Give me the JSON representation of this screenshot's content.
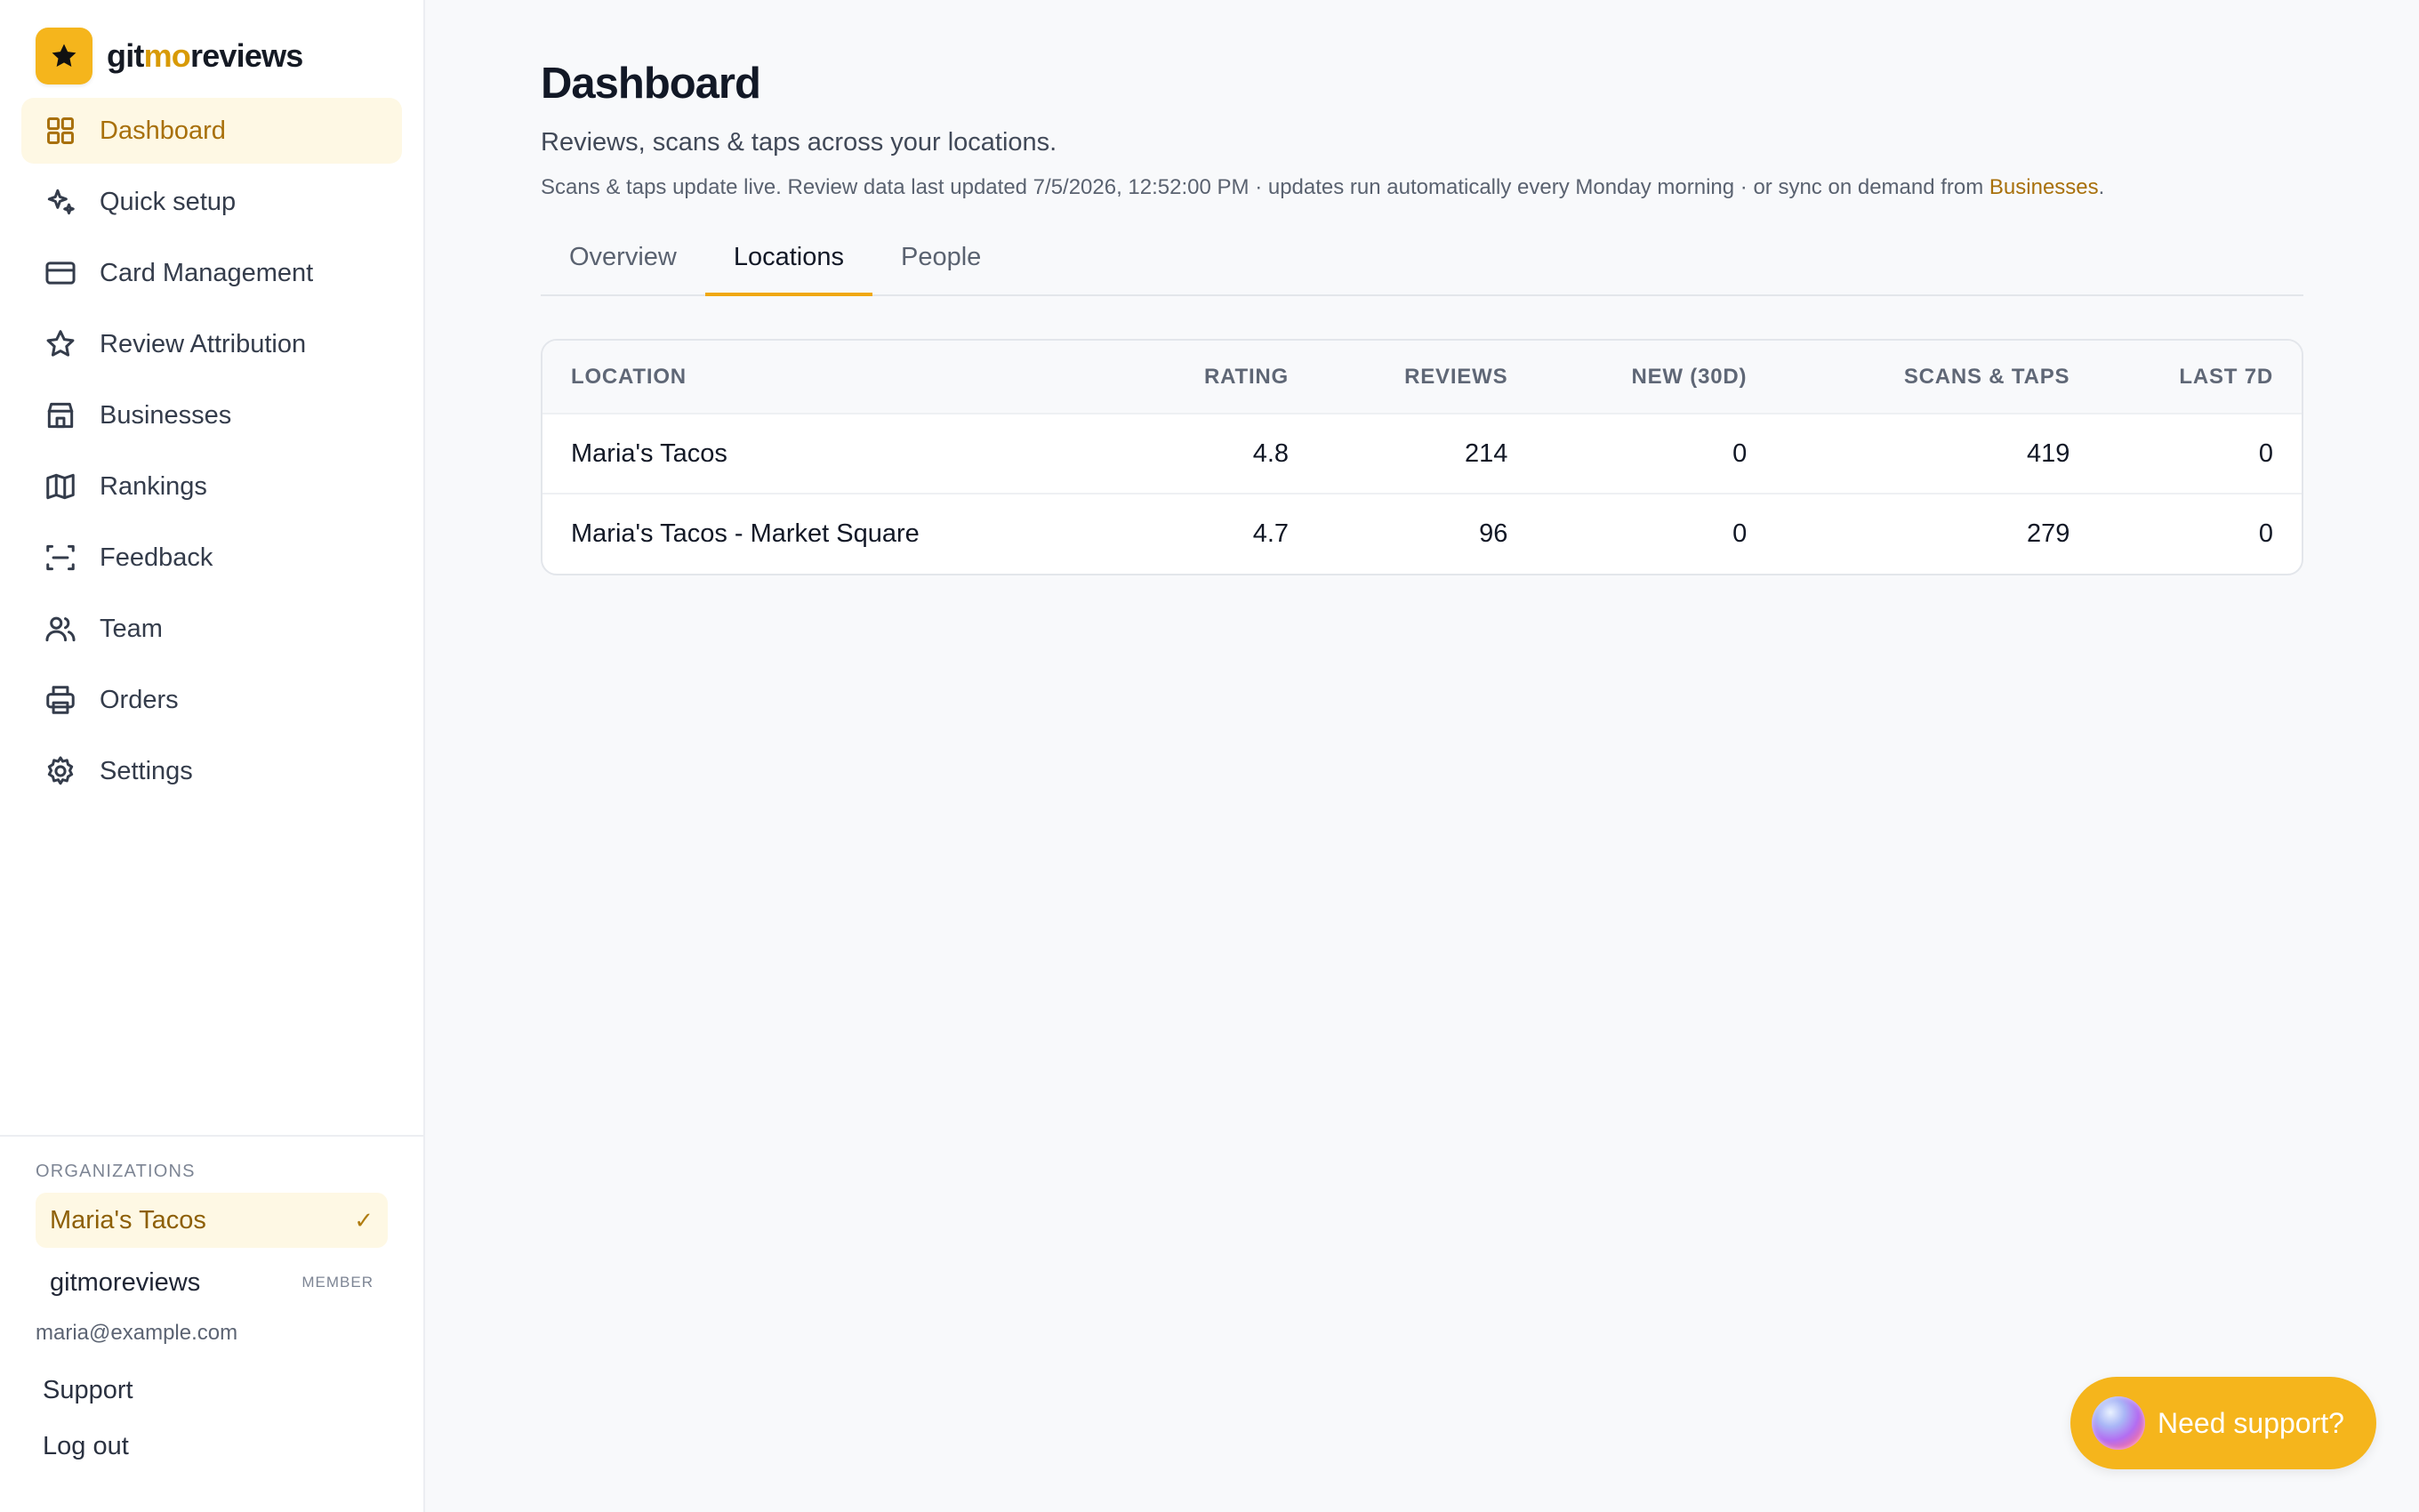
{
  "brand": {
    "name_part1": "git",
    "name_part2": "mo",
    "name_part3": "reviews"
  },
  "sidebar": {
    "items": [
      {
        "label": "Dashboard",
        "icon": "grid-icon"
      },
      {
        "label": "Quick setup",
        "icon": "sparkles-icon"
      },
      {
        "label": "Card Management",
        "icon": "credit-card-icon"
      },
      {
        "label": "Review Attribution",
        "icon": "star-icon"
      },
      {
        "label": "Businesses",
        "icon": "store-icon"
      },
      {
        "label": "Rankings",
        "icon": "map-icon"
      },
      {
        "label": "Feedback",
        "icon": "scan-icon"
      },
      {
        "label": "Team",
        "icon": "users-icon"
      },
      {
        "label": "Orders",
        "icon": "printer-icon"
      },
      {
        "label": "Settings",
        "icon": "gear-icon"
      }
    ],
    "active_item": "Dashboard",
    "organizations_heading": "ORGANIZATIONS",
    "organizations": [
      {
        "name": "Maria's Tacos",
        "selected": true
      },
      {
        "name": "gitmoreviews",
        "role": "MEMBER"
      }
    ],
    "user_email": "maria@example.com",
    "support_label": "Support",
    "logout_label": "Log out"
  },
  "page": {
    "title": "Dashboard",
    "subtitle": "Reviews, scans & taps across your locations.",
    "note_text": "Scans & taps update live. Review data last updated 7/5/2026, 12:52:00 PM · updates run automatically every Monday morning · or sync on demand from ",
    "note_link": "Businesses",
    "note_end": "."
  },
  "tabs": [
    {
      "label": "Overview"
    },
    {
      "label": "Locations",
      "active": true
    },
    {
      "label": "People"
    }
  ],
  "table": {
    "headers": [
      "LOCATION",
      "RATING",
      "REVIEWS",
      "NEW (30D)",
      "SCANS & TAPS",
      "LAST 7D"
    ],
    "rows": [
      [
        "Maria's Tacos",
        "4.8",
        "214",
        "0",
        "419",
        "0"
      ],
      [
        "Maria's Tacos - Market Square",
        "4.7",
        "96",
        "0",
        "279",
        "0"
      ]
    ]
  },
  "support_button": {
    "label": "Need support?"
  },
  "colors": {
    "accent": "#f5b51c",
    "accent_text": "#a8700b",
    "active_bg": "#fef8e4"
  }
}
